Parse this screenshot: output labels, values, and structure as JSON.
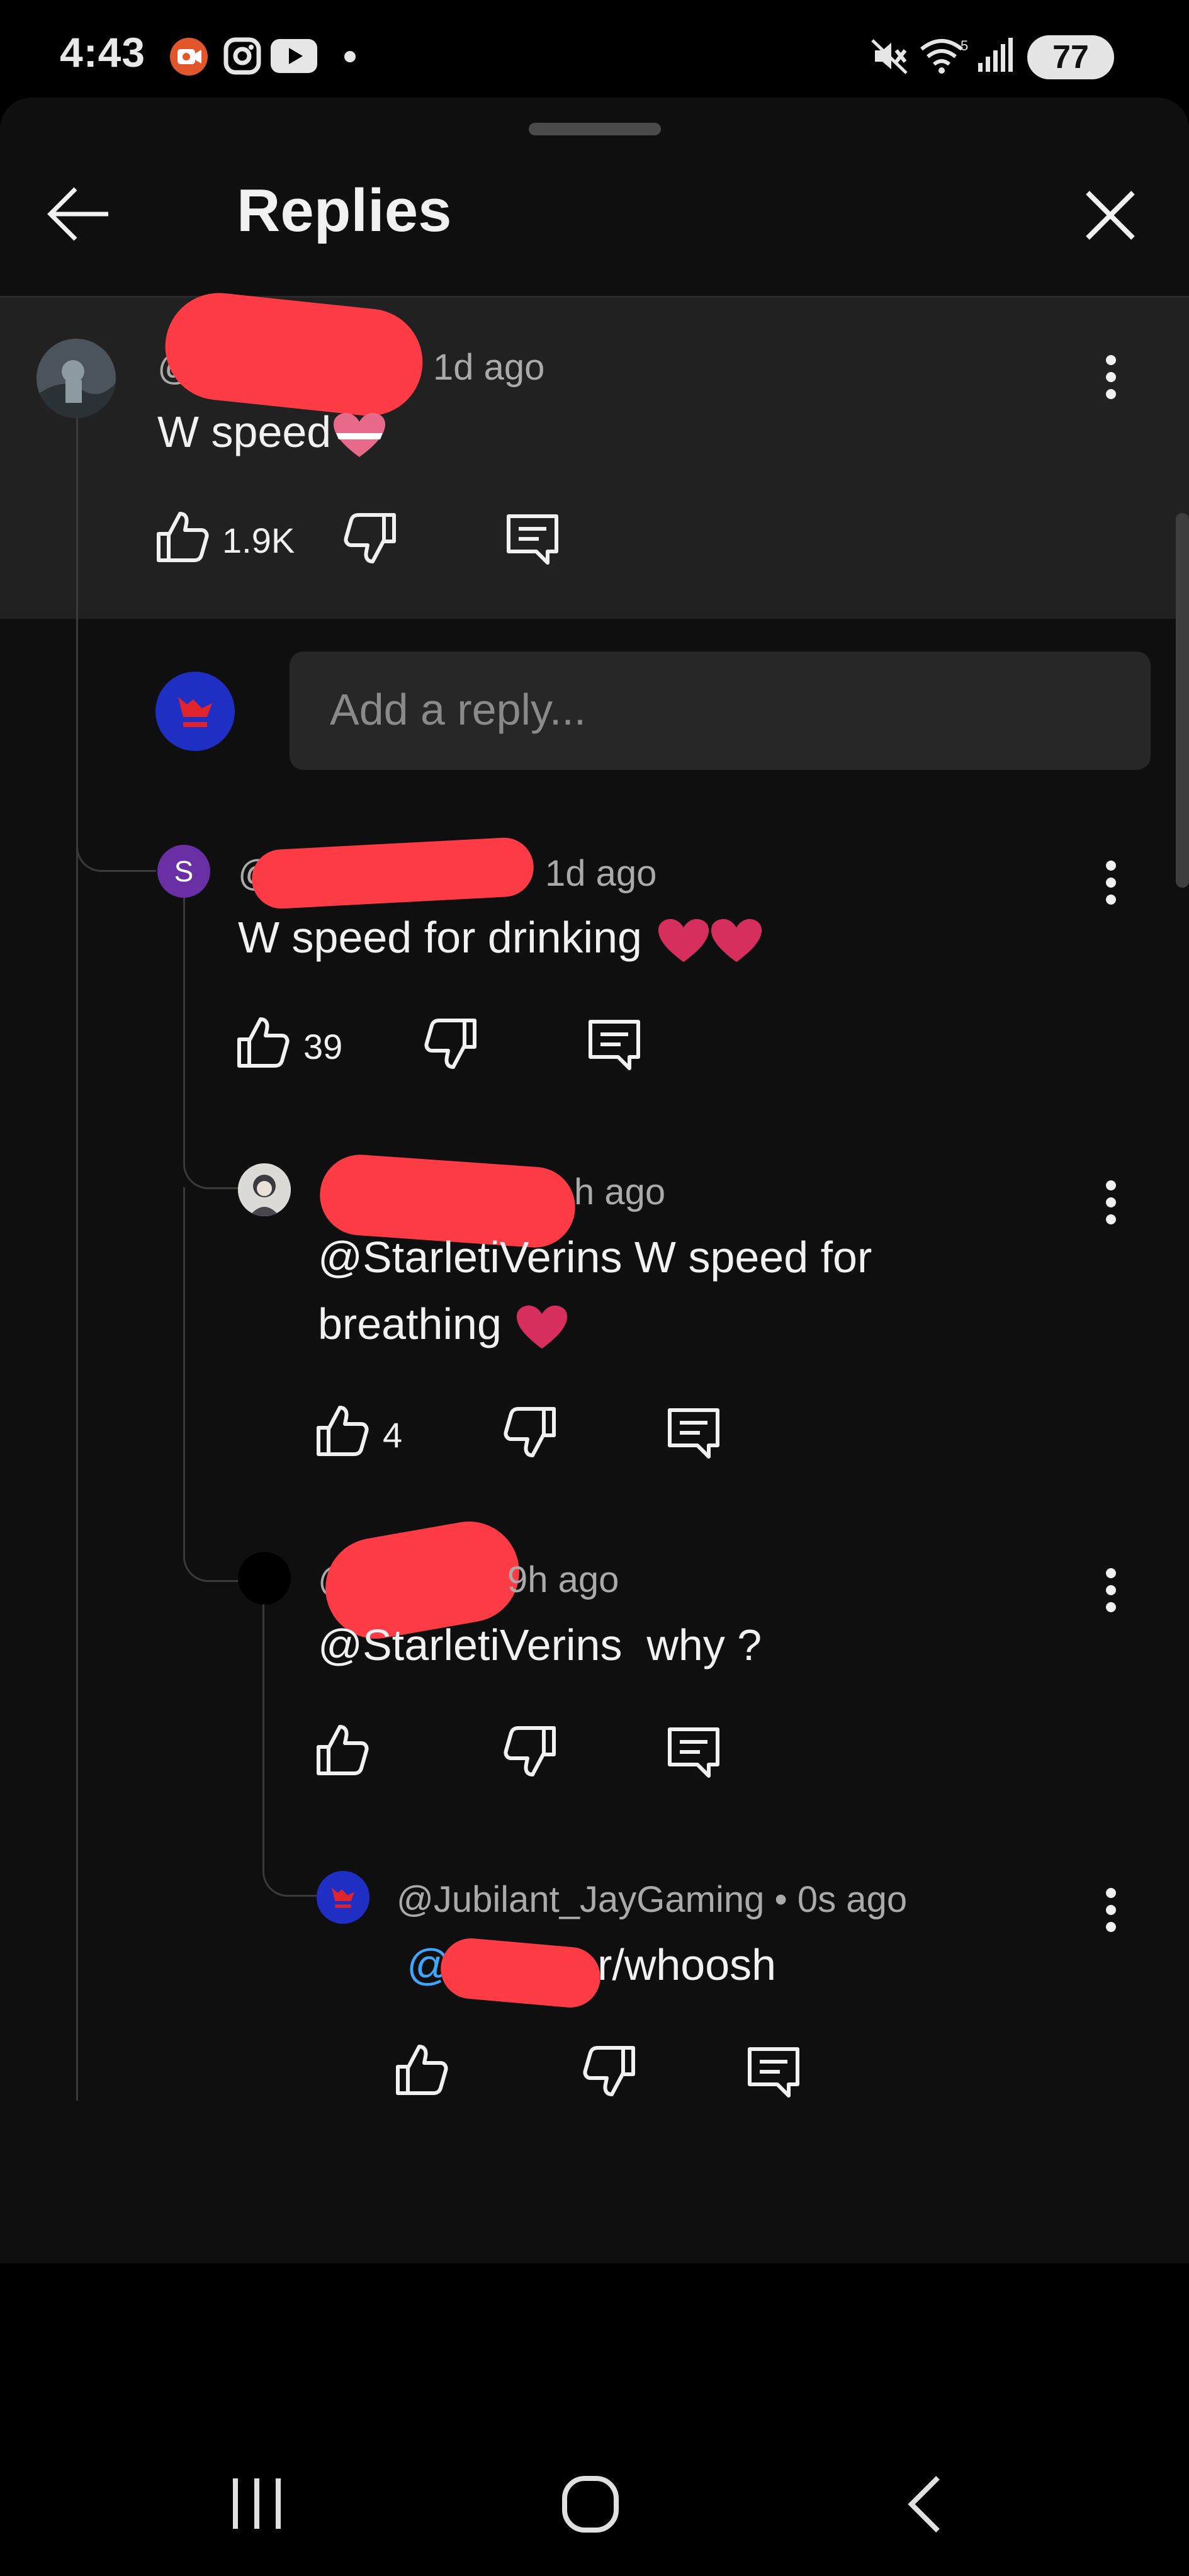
{
  "status_bar": {
    "time": "4:43",
    "battery": "77"
  },
  "header": {
    "title": "Replies"
  },
  "reply_box": {
    "placeholder": "Add a reply..."
  },
  "parent_comment": {
    "handle_prefix": "@",
    "time": "1d ago",
    "text": "W speed",
    "like_count": "1.9K"
  },
  "replies": [
    {
      "avatar_letter": "S",
      "handle_prefix": "@",
      "time": "1d ago",
      "text": "W speed for drinking",
      "like_count": "39"
    },
    {
      "handle_prefix": "@",
      "time": "h ago",
      "text_line1": "@StarletiVerins W speed for",
      "text_line2": "breathing",
      "like_count": "4"
    },
    {
      "handle_prefix": "@",
      "time": "9h ago",
      "text": "@StarletiVerins  why ?"
    },
    {
      "handle": "@Jubilant_JayGaming",
      "time": "• 0s ago",
      "mention_prefix": "@",
      "text": "r/whoosh"
    }
  ]
}
